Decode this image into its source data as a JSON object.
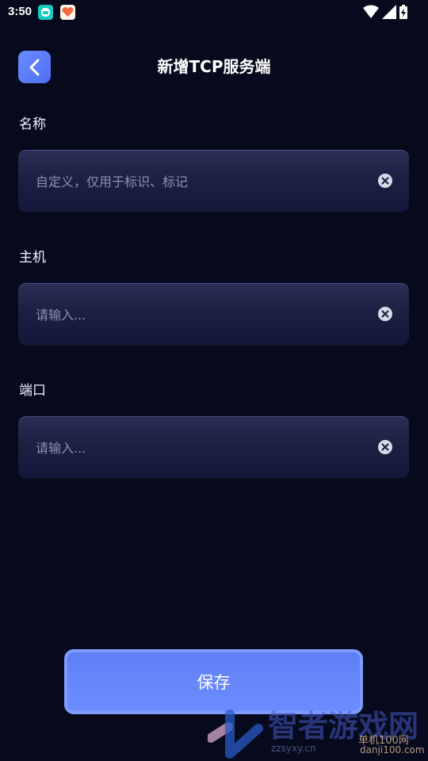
{
  "status_bar": {
    "time": "3:50"
  },
  "header": {
    "title": "新增TCP服务端",
    "back_icon": "chevron-left-icon"
  },
  "form": {
    "name": {
      "label": "名称",
      "value": "",
      "placeholder": "自定义，仅用于标识、标记"
    },
    "host": {
      "label": "主机",
      "value": "",
      "placeholder": "请输入..."
    },
    "port": {
      "label": "端口",
      "value": "",
      "placeholder": "请输入..."
    }
  },
  "actions": {
    "save_label": "保存"
  },
  "watermark": {
    "title": "智者游戏网",
    "url": "zzsyxy.cn",
    "brand": "单机100网",
    "brand_url": "danji100.com"
  },
  "colors": {
    "background": "#060a1c",
    "accent": "#5f80f5",
    "field_bg": "#1c2142",
    "placeholder": "#8d93b5"
  }
}
